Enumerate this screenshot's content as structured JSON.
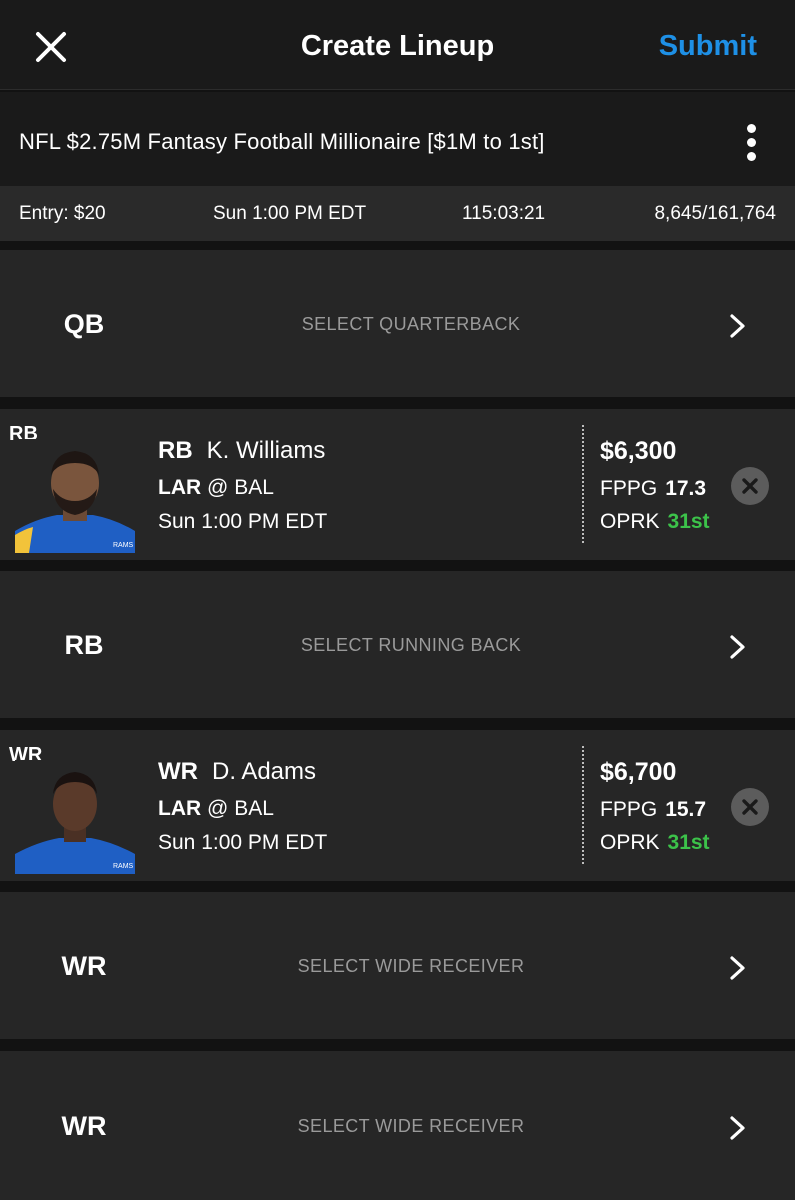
{
  "header": {
    "title": "Create Lineup",
    "submit_label": "Submit"
  },
  "contest": {
    "title": "NFL $2.75M Fantasy Football Millionaire [$1M to 1st]",
    "entry_fee": "Entry: $20",
    "start_time": "Sun 1:00 PM EDT",
    "countdown": "115:03:21",
    "entries": "8,645/161,764"
  },
  "slots": [
    {
      "position": "QB",
      "prompt": "SELECT QUARTERBACK"
    },
    {
      "position": "RB",
      "player": {
        "pos": "RB",
        "name": "K. Williams",
        "team": "LAR",
        "at": "@",
        "opponent": "BAL",
        "game_time": "Sun 1:00 PM EDT",
        "salary": "$6,300",
        "fppg_label": "FPPG",
        "fppg": "17.3",
        "oprk_label": "OPRK",
        "oprk": "31st"
      }
    },
    {
      "position": "RB",
      "prompt": "SELECT RUNNING BACK"
    },
    {
      "position": "WR",
      "player": {
        "pos": "WR",
        "name": "D. Adams",
        "team": "LAR",
        "at": "@",
        "opponent": "BAL",
        "game_time": "Sun 1:00 PM EDT",
        "salary": "$6,700",
        "fppg_label": "FPPG",
        "fppg": "15.7",
        "oprk_label": "OPRK",
        "oprk": "31st"
      }
    },
    {
      "position": "WR",
      "prompt": "SELECT WIDE RECEIVER"
    },
    {
      "position": "WR",
      "prompt": "SELECT WIDE RECEIVER"
    }
  ],
  "colors": {
    "accent": "#1e90e6",
    "rank_good": "#3cc24a",
    "jersey": "#1f5fc4"
  },
  "icons": [
    "close-icon",
    "kebab-menu-icon",
    "chevron-right-icon",
    "remove-icon"
  ]
}
